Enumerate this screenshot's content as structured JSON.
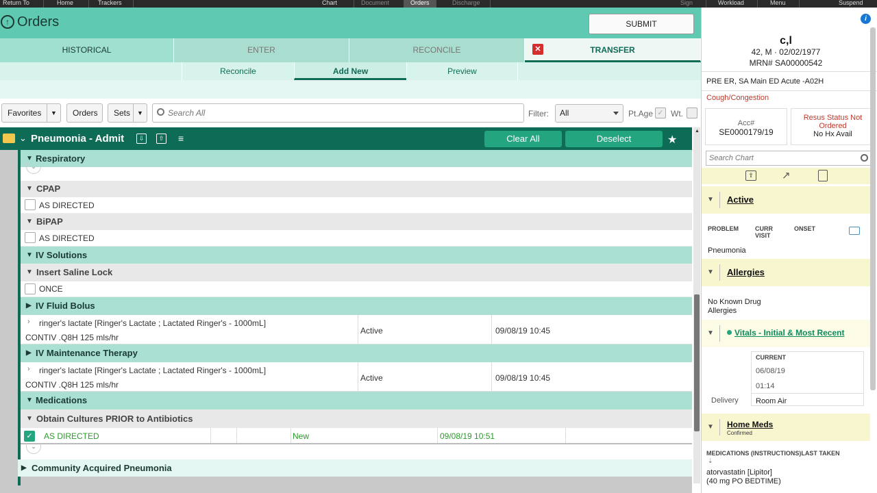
{
  "topbar": {
    "return_to": "Return To",
    "home": "Home",
    "trackers": "Trackers",
    "chart": "Chart",
    "document": "Document",
    "orders": "Orders",
    "discharge": "Discharge",
    "sign": "Sign",
    "workload": "Workload",
    "menu": "Menu",
    "suspend": "Suspend"
  },
  "header": {
    "title": "Orders",
    "submit": "SUBMIT"
  },
  "tabs": {
    "historical": "HISTORICAL",
    "enter": "ENTER",
    "reconcile": "RECONCILE",
    "transfer": "TRANSFER"
  },
  "subtabs": {
    "reconcile": "Reconcile",
    "add_new": "Add New",
    "preview": "Preview"
  },
  "toolbar": {
    "favorites": "Favorites",
    "orders": "Orders",
    "sets": "Sets",
    "search_placeholder": "Search All",
    "filter_label": "Filter:",
    "filter_value": "All",
    "ptage_label": "Pt.Age",
    "wt_label": "Wt."
  },
  "plan": {
    "title": "Pneumonia - Admit",
    "clear_all": "Clear All",
    "deselect": "Deselect"
  },
  "orders": {
    "respiratory": "Respiratory",
    "cpap": "CPAP",
    "cpap_opt": "AS DIRECTED",
    "bipap": "BiPAP",
    "bipap_opt": "AS DIRECTED",
    "iv_solutions": "IV Solutions",
    "saline_lock": "Insert Saline Lock",
    "saline_opt": "ONCE",
    "fluid_bolus": "IV Fluid Bolus",
    "bolus_line1": "ringer's lactate [Ringer's Lactate ; Lactated Ringer's - 1000mL]",
    "bolus_line2": "CONTIV .Q8H 125 mls/hr",
    "bolus_status": "Active",
    "bolus_date": "09/08/19 10:45",
    "maintenance": "IV Maintenance Therapy",
    "maint_line1": "ringer's lactate [Ringer's Lactate ; Lactated Ringer's - 1000mL]",
    "maint_line2": "CONTIV .Q8H 125 mls/hr",
    "maint_status": "Active",
    "maint_date": "09/08/19 10:45",
    "medications": "Medications",
    "cultures": "Obtain Cultures PRIOR to Antibiotics",
    "cultures_opt": "AS DIRECTED",
    "cultures_status": "New",
    "cultures_date": "09/08/19 10:51",
    "cap": "Community Acquired Pneumonia"
  },
  "patient": {
    "name": "c,l",
    "age_sex_dob": "42, M  ·  02/02/1977",
    "mrn": "MRN# SA00000542",
    "location": "PRE ER, SA Main ED  Acute -A02H",
    "complaint": "Cough/Congestion",
    "acc_label": "Acc#",
    "acc_value": "SE0000179/19",
    "resus_line1": "Resus Status Not",
    "resus_line2": "Ordered",
    "hx": "No Hx Avail",
    "search_chart": "Search Chart"
  },
  "summary": {
    "active": "Active",
    "col_problem": "PROBLEM",
    "col_curr_visit_1": "CURR",
    "col_curr_visit_2": "VISIT",
    "col_onset": "ONSET",
    "problem_1": "Pneumonia",
    "allergies": "Allergies",
    "allergy_line1": "No Known Drug",
    "allergy_line2": "Allergies",
    "vitals": "Vitals - Initial & Most Recent",
    "current": "CURRENT",
    "vitals_date": "06/08/19",
    "vitals_time": "01:14",
    "delivery_label": "Delivery",
    "delivery_value": "Room Air",
    "home_meds": "Home Meds",
    "confirmed": "Confirmed",
    "meds_header": "MEDICATIONS (INSTRUCTIONS)LAST TAKEN",
    "med_1": "atorvastatin [Lipitor]",
    "med_1_dose": "(40 mg PO BEDTIME)"
  },
  "colors": {
    "primary": "#0e6b55",
    "header": "#5fc9b1",
    "accent": "#23a57f",
    "alert": "#d32f2f"
  }
}
